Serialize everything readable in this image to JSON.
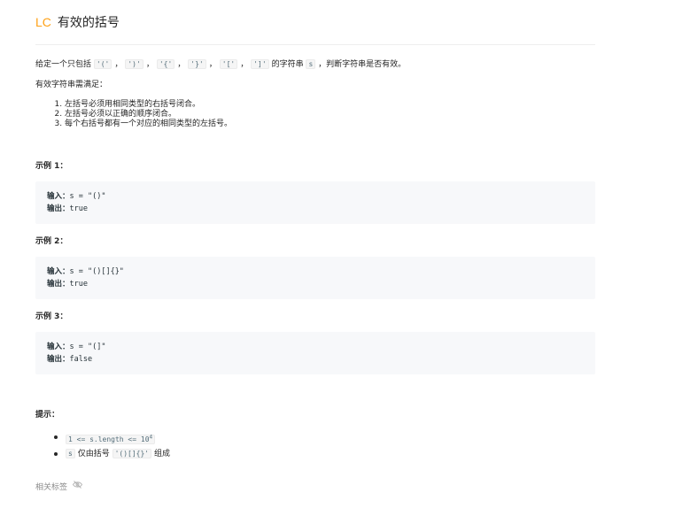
{
  "header": {
    "logo": "LC",
    "title": "有效的括号"
  },
  "description": {
    "intro_prefix": "给定一个只包括",
    "chars": [
      "'('",
      "')'",
      "'{'",
      "'}'",
      "'['",
      "']'"
    ],
    "separator": "，",
    "intro_mid": "的字符串",
    "var_s": "s",
    "intro_suffix": "，判断字符串是否有效。",
    "valid_intro": "有效字符串需满足：",
    "rules": [
      "左括号必须用相同类型的右括号闭合。",
      "左括号必须以正确的顺序闭合。",
      "每个右括号都有一个对应的相同类型的左括号。"
    ]
  },
  "examples": [
    {
      "title": "示例 1：",
      "input_label": "输入：",
      "input": "s = \"()\"",
      "output_label": "输出：",
      "output": "true"
    },
    {
      "title": "示例 2：",
      "input_label": "输入：",
      "input": "s = \"()[]{}\"",
      "output_label": "输出：",
      "output": "true"
    },
    {
      "title": "示例 3：",
      "input_label": "输入：",
      "input": "s = \"(]\"",
      "output_label": "输出：",
      "output": "false"
    }
  ],
  "hints": {
    "title": "提示：",
    "c1_code": "1 <= s.length <= 10",
    "c1_exp": "4",
    "c2_var": "s",
    "c2_mid": "仅由括号",
    "c2_code": "'()[]{}'",
    "c2_suffix": "组成"
  },
  "tags": {
    "label": "相关标签",
    "icon": "eye-slash-icon"
  }
}
